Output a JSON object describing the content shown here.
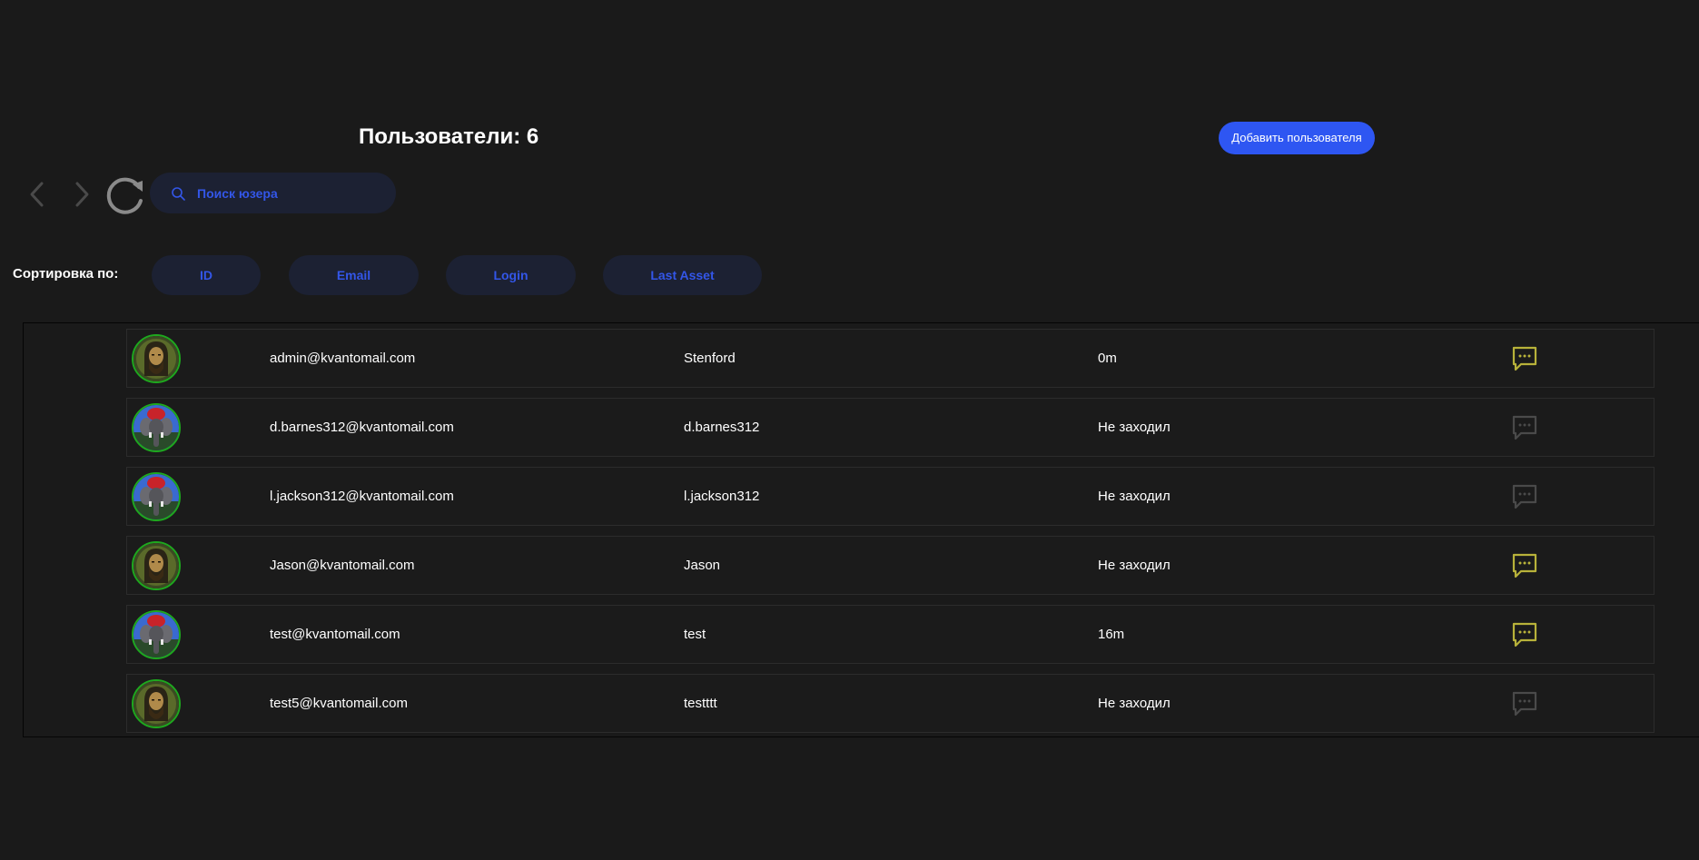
{
  "header": {
    "title": "Пользователи: 6",
    "add_button_label": "Добавить пользователя"
  },
  "toolbar": {
    "back_icon": "chevron-left-icon",
    "forward_icon": "chevron-right-icon",
    "refresh_icon": "refresh-icon",
    "search_placeholder": "Поиск юзера",
    "search_value": ""
  },
  "sort": {
    "label": "Сортировка по:",
    "options": [
      "ID",
      "Email",
      "Login",
      "Last Asset"
    ]
  },
  "users": [
    {
      "avatar": "icon-portrait",
      "email": "admin@kvantomail.com",
      "login": "Stenford",
      "last_seen": "0m",
      "chat_active": true
    },
    {
      "avatar": "elephant-portrait",
      "email": "d.barnes312@kvantomail.com",
      "login": "d.barnes312",
      "last_seen": "Не заходил",
      "chat_active": false
    },
    {
      "avatar": "elephant-portrait",
      "email": "l.jackson312@kvantomail.com",
      "login": "l.jackson312",
      "last_seen": "Не заходил",
      "chat_active": false
    },
    {
      "avatar": "icon-portrait",
      "email": "Jason@kvantomail.com",
      "login": "Jason",
      "last_seen": "Не заходил",
      "chat_active": true
    },
    {
      "avatar": "elephant-portrait",
      "email": "test@kvantomail.com",
      "login": "test",
      "last_seen": "16m",
      "chat_active": true
    },
    {
      "avatar": "icon-portrait",
      "email": "test5@kvantomail.com",
      "login": "testttt",
      "last_seen": "Не заходил",
      "chat_active": false
    }
  ],
  "colors": {
    "background": "#1a1a1a",
    "accent": "#2e56f2",
    "pill_bg": "#1c2133",
    "pill_text": "#3356e8",
    "chat_active": "#b8b23a",
    "chat_inactive": "#4a4a4a",
    "avatar_border": "#1ea81e"
  }
}
